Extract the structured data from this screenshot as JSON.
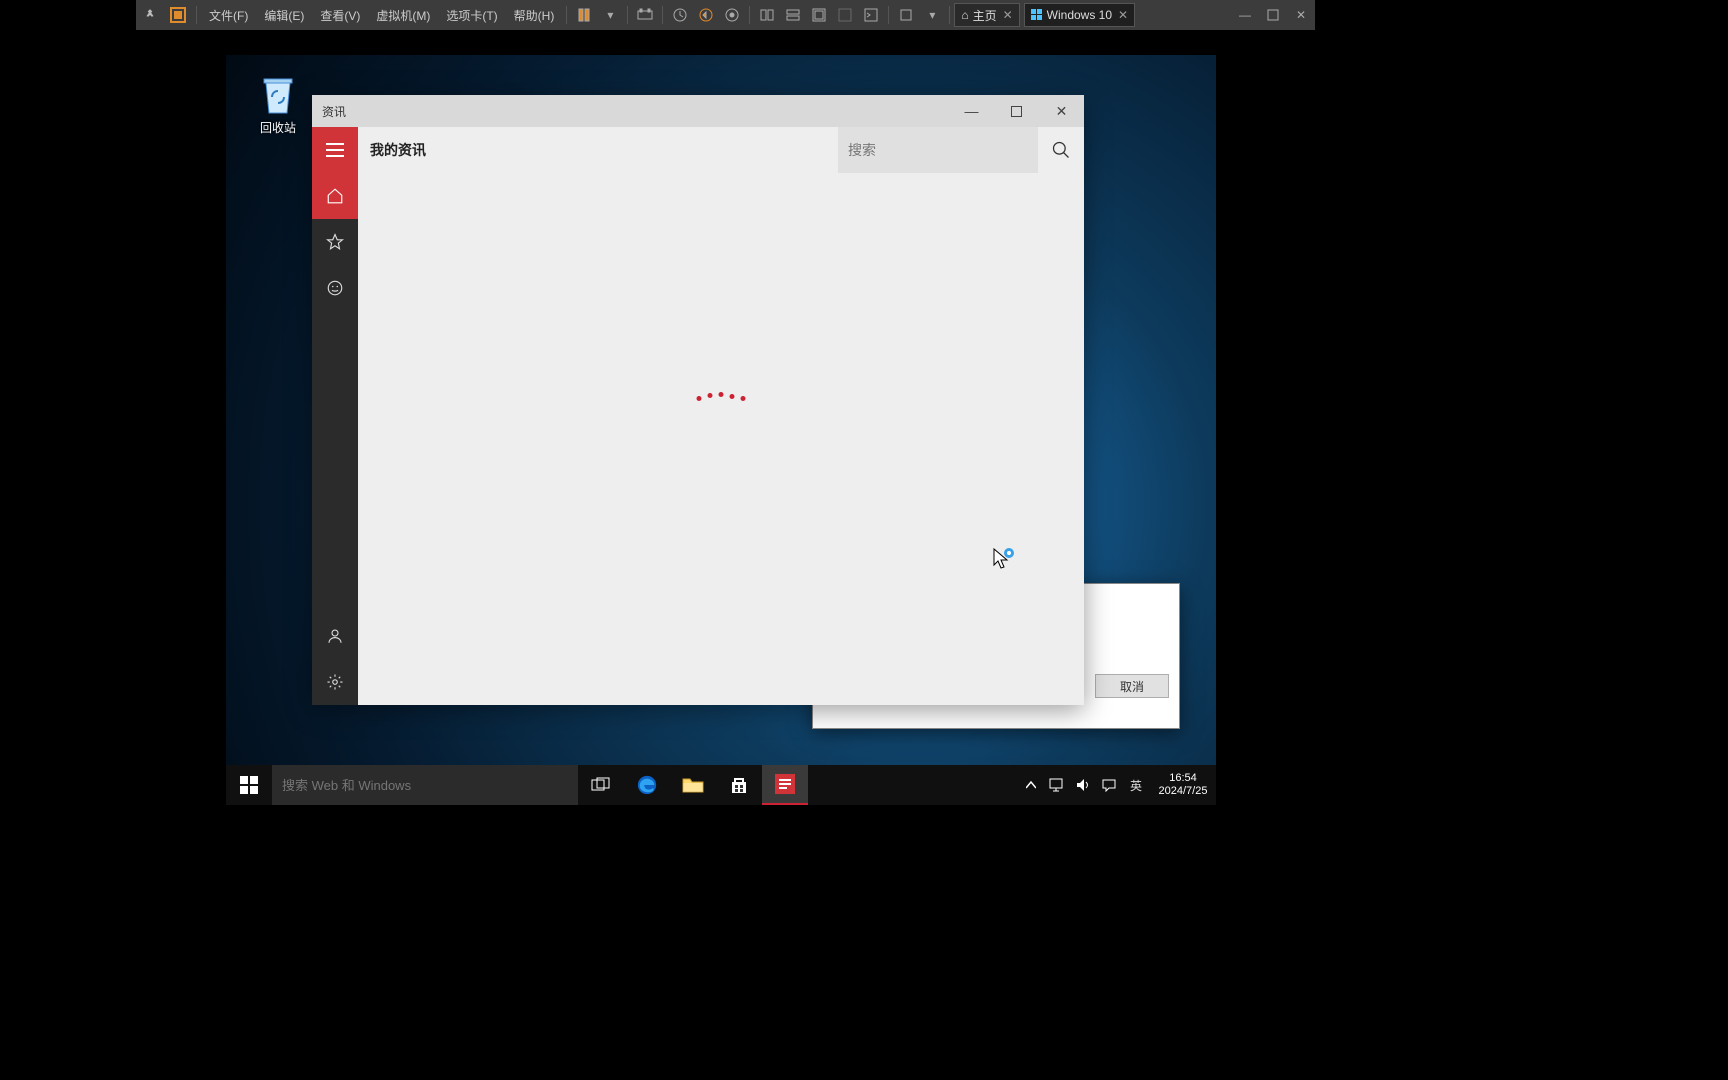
{
  "vmware": {
    "menus": [
      "文件(F)",
      "编辑(E)",
      "查看(V)",
      "虚拟机(M)",
      "选项卡(T)",
      "帮助(H)"
    ],
    "tabs": [
      {
        "label": "主页",
        "icon": "home"
      },
      {
        "label": "Windows 10",
        "icon": "windows"
      }
    ]
  },
  "desktop": {
    "recycle_label": "回收站"
  },
  "news": {
    "window_title": "资讯",
    "header_title": "我的资讯",
    "search_placeholder": "搜索",
    "rail": {
      "hamburger": "菜单",
      "home": "主页",
      "star": "收藏",
      "smile": "反馈",
      "user": "用户",
      "settings": "设置"
    }
  },
  "dialog": {
    "cancel": "取消"
  },
  "taskbar": {
    "search_placeholder": "搜索 Web 和 Windows",
    "ime": "英",
    "time": "16:54",
    "date": "2024/7/25"
  }
}
